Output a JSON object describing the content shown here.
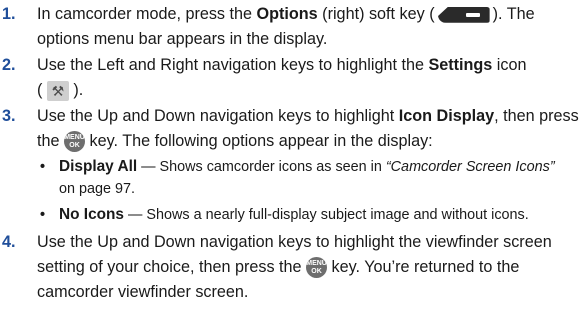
{
  "steps": [
    {
      "number": "1.",
      "line1_a": "In camcorder mode, press the ",
      "line1_b": "Options",
      "line1_c": " (right) soft key (",
      "line1_d": "). The",
      "line2": "options menu bar appears in the display."
    },
    {
      "number": "2.",
      "line1_a": "Use the Left and Right navigation keys to highlight the ",
      "line1_b": "Settings",
      "line1_c": " icon",
      "line2_a": "(",
      "line2_b": ")."
    },
    {
      "number": "3.",
      "line1_a": "Use the Up and Down navigation keys to highlight ",
      "line1_b": "Icon Display",
      "line1_c": ", then press",
      "line2_a": "the ",
      "line2_b": " key. The following options appear in the display:"
    },
    {
      "number": "4.",
      "line1": "Use the Up and Down navigation keys to highlight the viewfinder screen",
      "line2_a": "setting of your choice, then press the ",
      "line2_b": " key. You’re returned to the",
      "line3": "camcorder viewfinder screen."
    }
  ],
  "options": [
    {
      "bullet": "•",
      "title": "Display All",
      "desc_a": " — Shows camcorder icons as seen in ",
      "ref": "“Camcorder Screen Icons”",
      "desc_b": "on page 97."
    },
    {
      "bullet": "•",
      "title": "No Icons",
      "desc": " — Shows a nearly full-display subject image and without icons."
    }
  ],
  "icons": {
    "softkey": "right-soft-key-icon",
    "settings": "settings-icon",
    "settings_glyph": "⚒",
    "ok_key": "menu-ok-key-icon",
    "ok_top": "MENU",
    "ok_bottom": "OK"
  },
  "colors": {
    "step_number": "#1f4e9a"
  }
}
